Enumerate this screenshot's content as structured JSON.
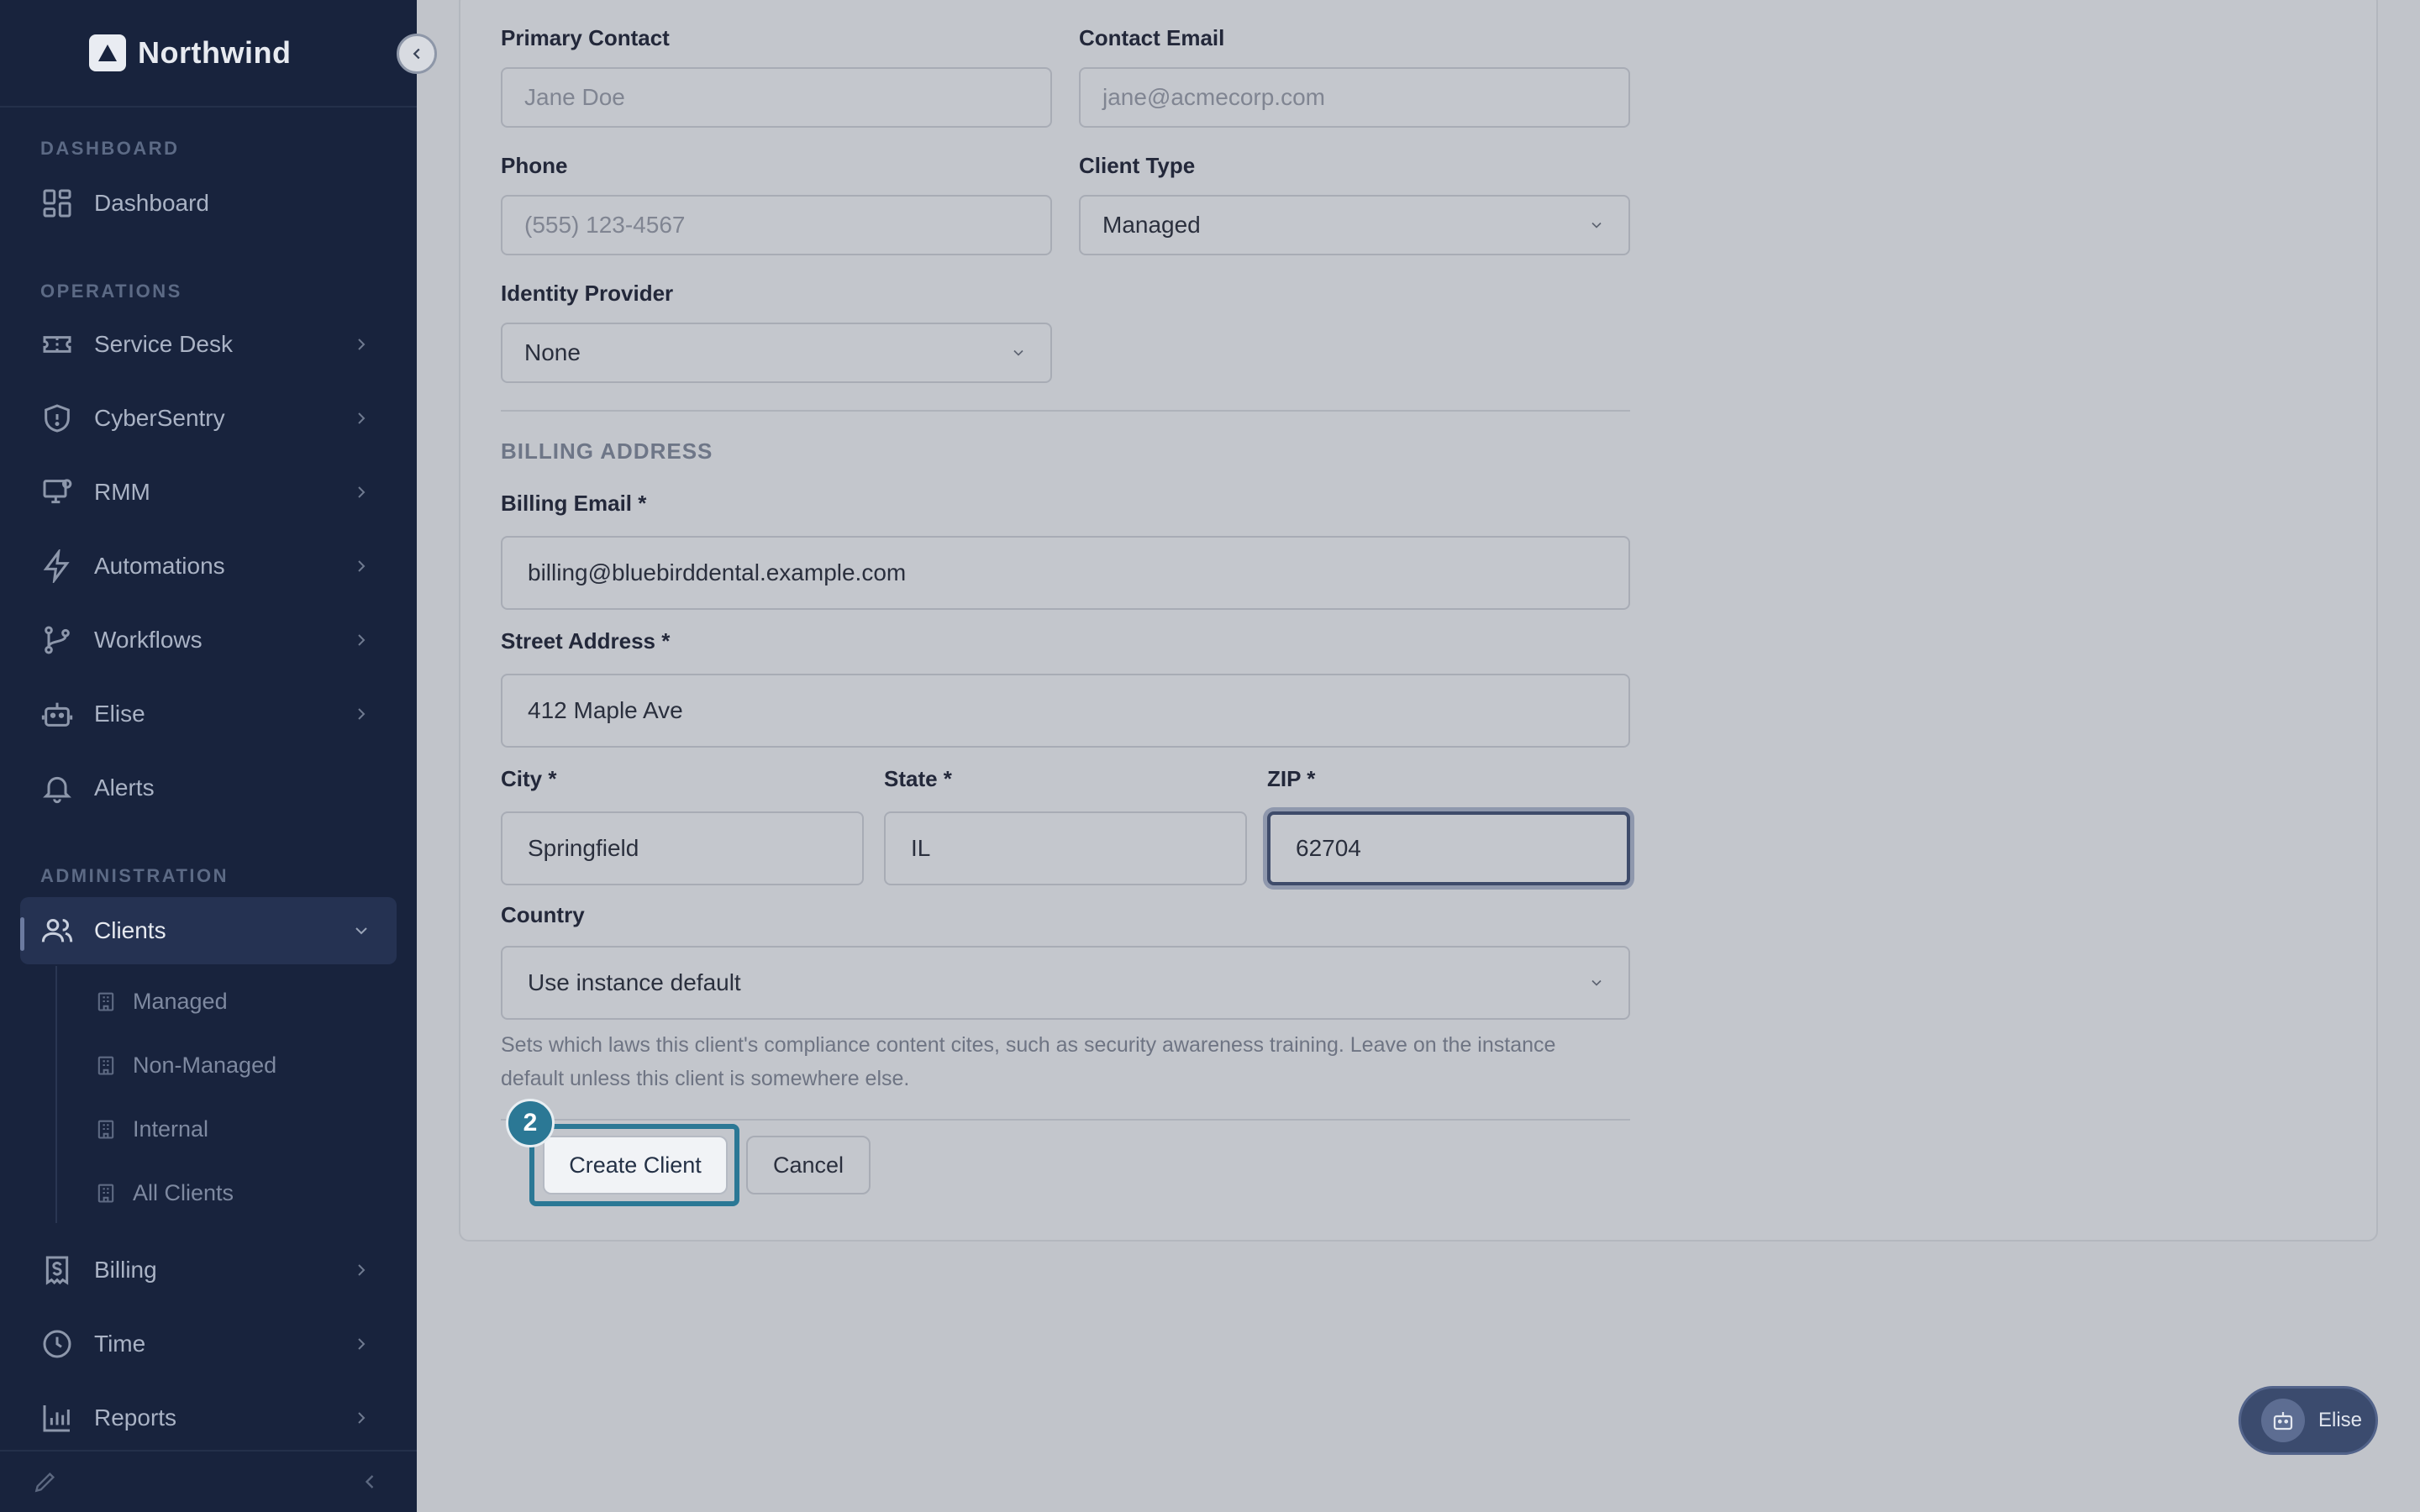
{
  "brand": {
    "name": "Northwind"
  },
  "sidebar": {
    "sections": {
      "dashboard": "DASHBOARD",
      "operations": "OPERATIONS",
      "administration": "ADMINISTRATION"
    },
    "items": {
      "dashboard": "Dashboard",
      "service_desk": "Service Desk",
      "cybersentry": "CyberSentry",
      "rmm": "RMM",
      "automations": "Automations",
      "workflows": "Workflows",
      "elise": "Elise",
      "alerts": "Alerts",
      "clients": "Clients",
      "billing": "Billing",
      "time": "Time",
      "reports": "Reports"
    },
    "clients_sub": [
      "Managed",
      "Non-Managed",
      "Internal",
      "All Clients"
    ]
  },
  "form": {
    "primary_contact": {
      "label": "Primary Contact",
      "placeholder": "Jane Doe"
    },
    "contact_email": {
      "label": "Contact Email",
      "placeholder": "jane@acmecorp.com"
    },
    "phone": {
      "label": "Phone",
      "placeholder": "(555) 123-4567"
    },
    "client_type": {
      "label": "Client Type",
      "value": "Managed"
    },
    "identity_provider": {
      "label": "Identity Provider",
      "value": "None"
    },
    "billing_section_title": "BILLING ADDRESS",
    "billing_email": {
      "label": "Billing Email *",
      "value": "billing@bluebirddental.example.com"
    },
    "street_address": {
      "label": "Street Address *",
      "value": "412 Maple Ave"
    },
    "city": {
      "label": "City *",
      "value": "Springfield"
    },
    "state": {
      "label": "State *",
      "value": "IL"
    },
    "zip": {
      "label": "ZIP *",
      "value": "62704"
    },
    "country": {
      "label": "Country",
      "value": "Use instance default",
      "help_line1": "Sets which laws this client's compliance content cites, such as security awareness training. Leave on the instance",
      "help_line2": "default unless this client is somewhere else."
    },
    "create_button": "Create Client",
    "cancel_button": "Cancel",
    "step_badge": "2"
  },
  "assistant": {
    "label": "Elise"
  },
  "colors": {
    "sidebar_bg": "#18233d",
    "accent": "#2b7895",
    "page_bg": "#c1c4ca"
  }
}
